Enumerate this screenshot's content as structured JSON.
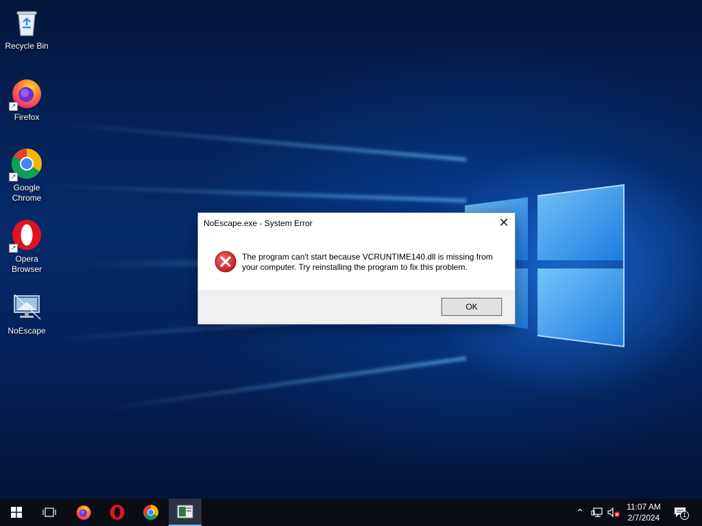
{
  "desktop": {
    "icons": [
      {
        "label": "Recycle Bin"
      },
      {
        "label": "Firefox"
      },
      {
        "label": "Google\nChrome"
      },
      {
        "label": "Opera\nBrowser"
      },
      {
        "label": "NoEscape"
      }
    ]
  },
  "dialog": {
    "title": "NoEscape.exe - System Error",
    "close_glyph": "✕",
    "message": "The program can't start because VCRUNTIME140.dll is missing from your computer. Try reinstalling the program to fix this problem.",
    "ok_label": "OK"
  },
  "taskbar": {
    "clock_time": "11:07 AM",
    "clock_date": "2/7/2024",
    "notification_count": "1",
    "chevron_glyph": "⌃"
  },
  "colors": {
    "error_red": "#d9262e",
    "taskbar": "#0b0d14",
    "active_underline": "#78b8ef"
  }
}
